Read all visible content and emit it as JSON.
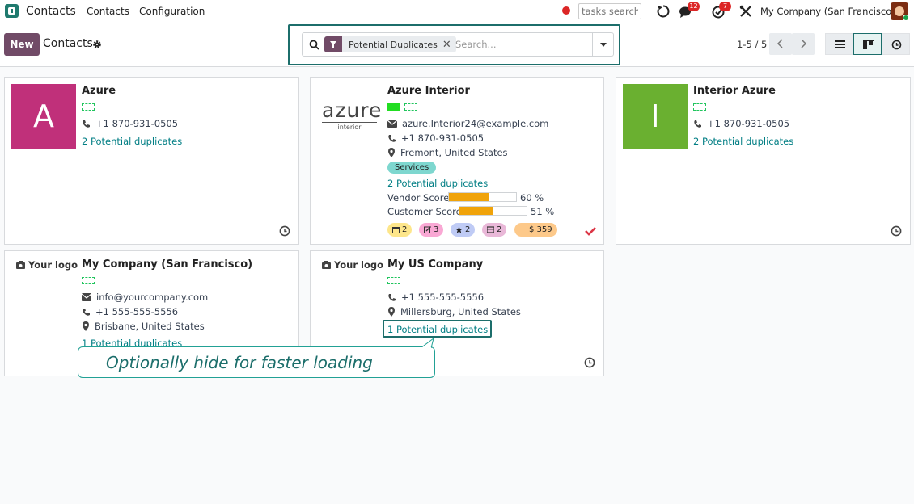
{
  "navbar": {
    "brand": "Contacts",
    "menu": [
      "Contacts",
      "Configuration"
    ],
    "tasks_search_placeholder": "tasks search",
    "messages_count": "12",
    "activities_count": "7",
    "company": "My Company (San Francisco)"
  },
  "control": {
    "new_label": "New",
    "title": "Contacts",
    "facet_label": "Potential Duplicates",
    "search_placeholder": "Search...",
    "pager": "1-5 / 5"
  },
  "cards": [
    {
      "name": "Azure",
      "initial": "A",
      "color": "#c0307a",
      "phone": "+1 870-931-0505",
      "duplicates": "2 Potential duplicates"
    },
    {
      "name": "Azure Interior",
      "logo_word": "azure",
      "logo_sub": "interior",
      "email": "azure.Interior24@example.com",
      "phone": "+1 870-931-0505",
      "location": "Fremont, United States",
      "tag": "Services",
      "duplicates": "2 Potential duplicates",
      "vendor_label": "Vendor Score",
      "vendor_score": 60,
      "vendor_pct": "60 %",
      "customer_label": "Customer Score",
      "customer_score": 51,
      "customer_pct": "51 %",
      "stats": [
        {
          "value": "2",
          "color": "#fde68a",
          "icon": "calendar-icon"
        },
        {
          "value": "3",
          "color": "#f9a8d4",
          "icon": "edit-icon"
        },
        {
          "value": "2",
          "color": "#bfcbf5",
          "icon": "star-icon"
        },
        {
          "value": "2",
          "color": "#e9b8d8",
          "icon": "card-icon"
        },
        {
          "value": "$ 359",
          "color": "#fdc98a",
          "icon": "dollar-icon"
        }
      ]
    },
    {
      "name": "Interior Azure",
      "initial": "I",
      "color": "#6ab030",
      "phone": "+1 870-931-0505",
      "duplicates": "2 Potential duplicates"
    },
    {
      "name": "My Company (San Francisco)",
      "logo": "Your logo",
      "email": "info@yourcompany.com",
      "phone": "+1 555-555-5556",
      "location": "Brisbane, United States",
      "duplicates": "1 Potential duplicates"
    },
    {
      "name": "My US Company",
      "logo": "Your logo",
      "phone": "+1 555-555-5556",
      "location": "Millersburg, United States",
      "duplicates": "1 Potential duplicates"
    }
  ],
  "callout": {
    "text": "Optionally hide for faster loading"
  }
}
